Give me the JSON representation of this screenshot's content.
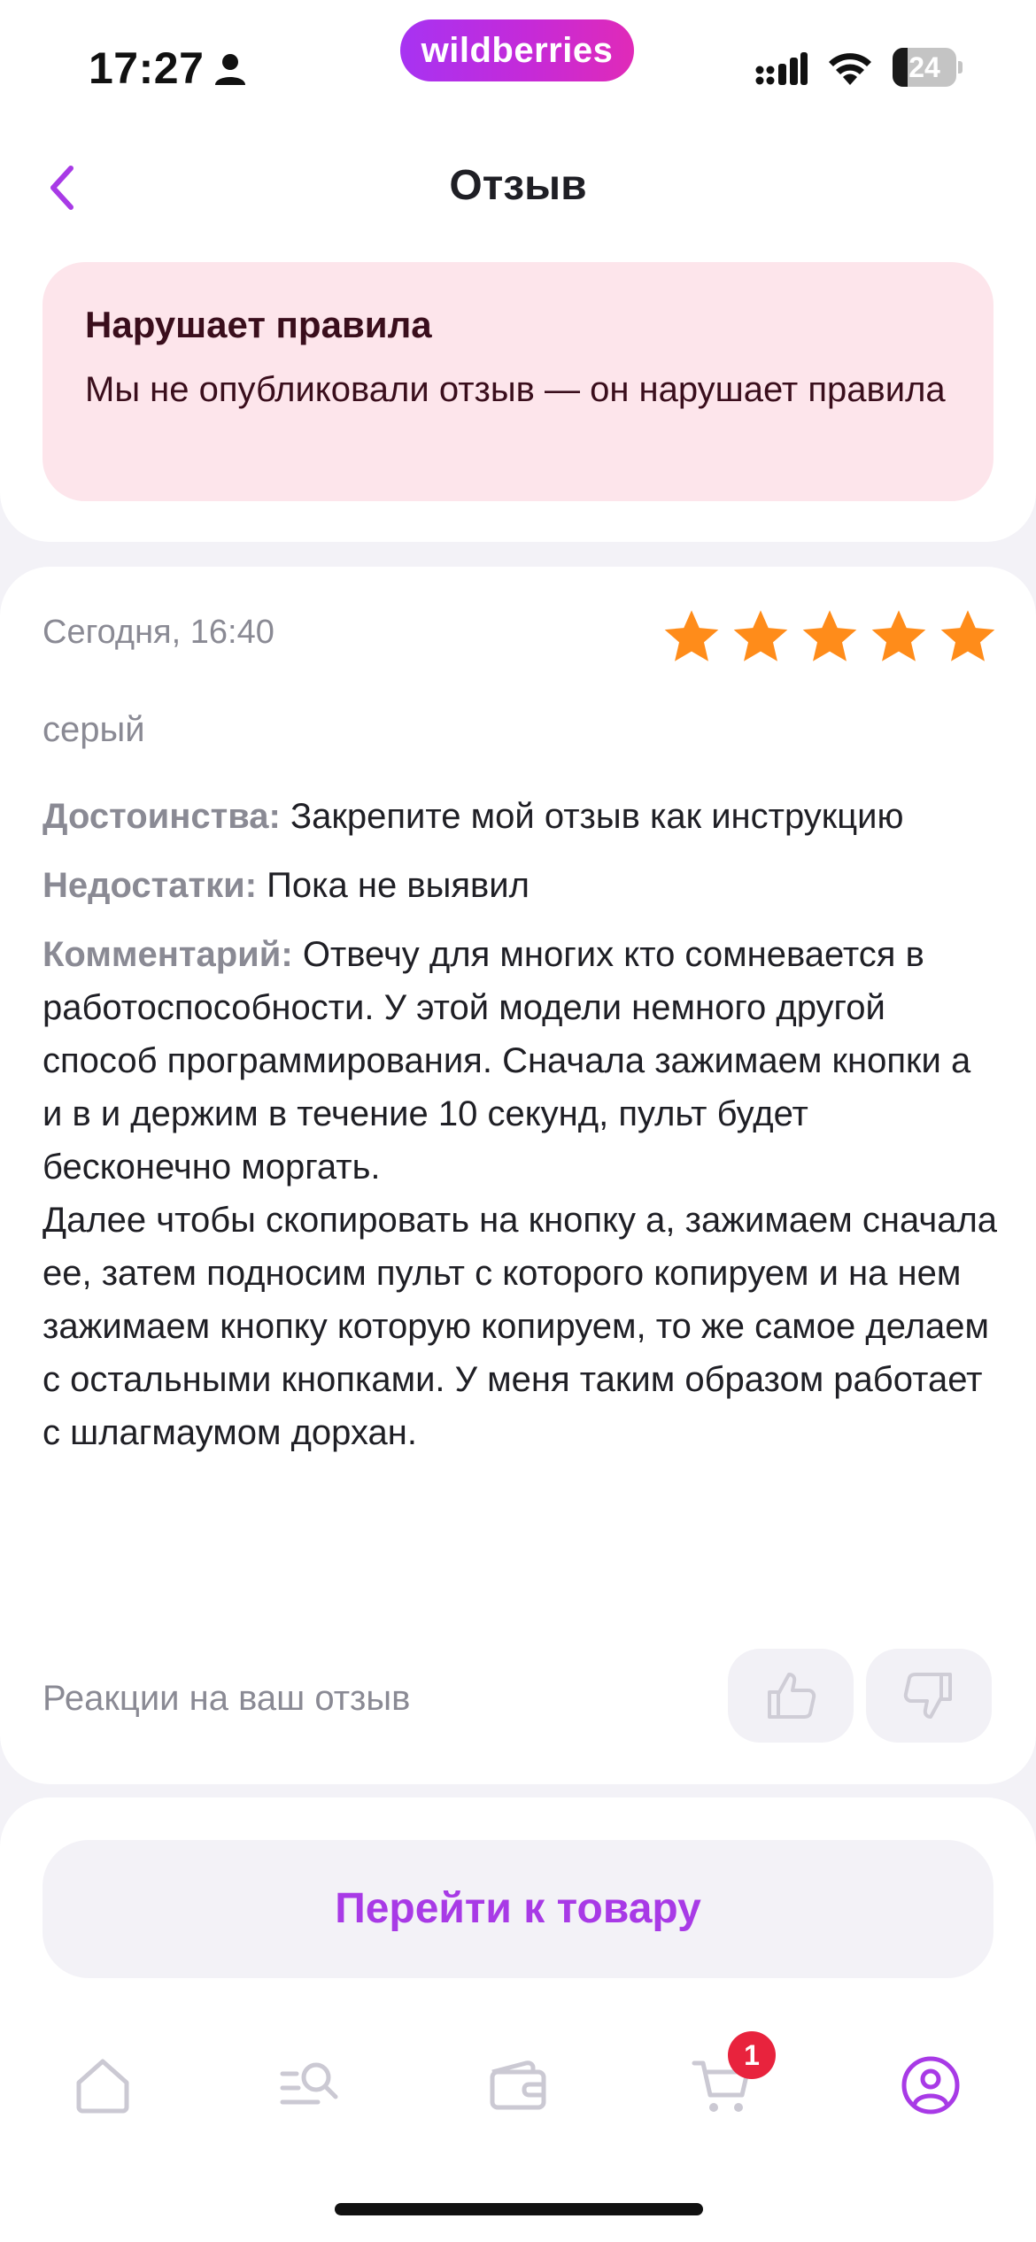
{
  "status_bar": {
    "time": "17:27",
    "brand": "wildberries",
    "battery_level": "24",
    "battery_fraction": 0.24
  },
  "header": {
    "title": "Отзыв",
    "back_icon": "chevron-left-icon"
  },
  "alert": {
    "title": "Нарушает правила",
    "text": "Мы не опубликовали отзыв — он нарушает правила",
    "background": "#fde5eb"
  },
  "review": {
    "date": "Сегодня, 16:40",
    "rating": 5,
    "max_rating": 5,
    "star_color": "#ff8c1a",
    "variant": "серый",
    "pros_label": "Достоинства:",
    "pros_text": "Закрепите мой отзыв как инструкцию",
    "cons_label": "Недостатки:",
    "cons_text": "Пока не выявил",
    "comment_label": "Комментарий:",
    "comment_text": "Отвечу для многих кто сомневается в работоспособности. У этой модели немного другой способ программирования. Сначала зажимаем кнопки а и в и держим в течение 10 секунд, пульт будет бесконечно моргать.\nДалее чтобы скопировать на кнопку а, зажимаем сначала ее, затем подносим пульт с которого копируем и на нем зажимаем кнопку которую копируем, то же самое делаем с остальными кнопками. У меня таким образом работает с шлагмаумом дорхан.",
    "reactions_label": "Реакции на ваш отзыв"
  },
  "actions": {
    "goto_product_label": "Перейти к товару",
    "accent": "#a83ae6"
  },
  "tab_bar": {
    "items": [
      {
        "name": "home",
        "icon": "home-icon"
      },
      {
        "name": "catalog",
        "icon": "catalog-search-icon"
      },
      {
        "name": "wallet",
        "icon": "wallet-icon"
      },
      {
        "name": "cart",
        "icon": "cart-icon",
        "badge": "1"
      },
      {
        "name": "profile",
        "icon": "profile-icon",
        "active": true
      }
    ],
    "badge_color": "#e8233d"
  }
}
